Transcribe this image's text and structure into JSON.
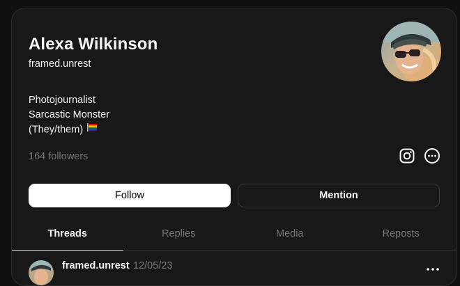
{
  "profile": {
    "name": "Alexa Wilkinson",
    "username": "framed.unrest",
    "bio": [
      "Photojournalist",
      "Sarcastic Monster",
      "(They/them)"
    ],
    "bio_flag_icon": "rainbow-flag-icon",
    "followers": "164 followers",
    "instagram_icon": "instagram-icon",
    "more_icon": "more-icon"
  },
  "actions": {
    "follow_label": "Follow",
    "mention_label": "Mention"
  },
  "tabs": [
    {
      "label": "Threads",
      "active": true
    },
    {
      "label": "Replies",
      "active": false
    },
    {
      "label": "Media",
      "active": false
    },
    {
      "label": "Reposts",
      "active": false
    }
  ],
  "post": {
    "username": "framed.unrest",
    "date": "12/05/23"
  },
  "colors": {
    "background": "#101010",
    "card": "#181818",
    "text": "#f3f5f7",
    "muted": "#777777",
    "follow_button": "#ffffff"
  }
}
